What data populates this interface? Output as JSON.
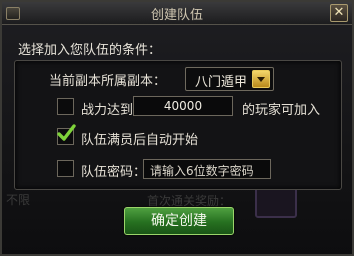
{
  "dialog": {
    "title": "创建队伍",
    "close_symbol": "✕"
  },
  "conditions": {
    "heading": "选择加入您队伍的条件：",
    "dungeon_label": "当前副本所属副本：",
    "dungeon_value": "八门遁甲",
    "power_checked": false,
    "power_label_prefix": "战力达到",
    "power_value": "40000",
    "power_label_suffix": "的玩家可加入",
    "autostart_checked": true,
    "autostart_label": "队伍满员后自动开始",
    "password_checked": false,
    "password_label": "队伍密码：",
    "password_placeholder": "请输入6位数字密码"
  },
  "background": {
    "left_text": "不限",
    "mid_text": "首次通关奖励："
  },
  "footer": {
    "confirm_label": "确定创建"
  },
  "colors": {
    "accent_green": "#267020",
    "checkmark": "#7ed23a",
    "dropdown_arrow": "#e8c95a"
  },
  "icons": {
    "close": "close-icon",
    "dropdown": "chevron-down-icon",
    "check": "checkmark-icon"
  }
}
